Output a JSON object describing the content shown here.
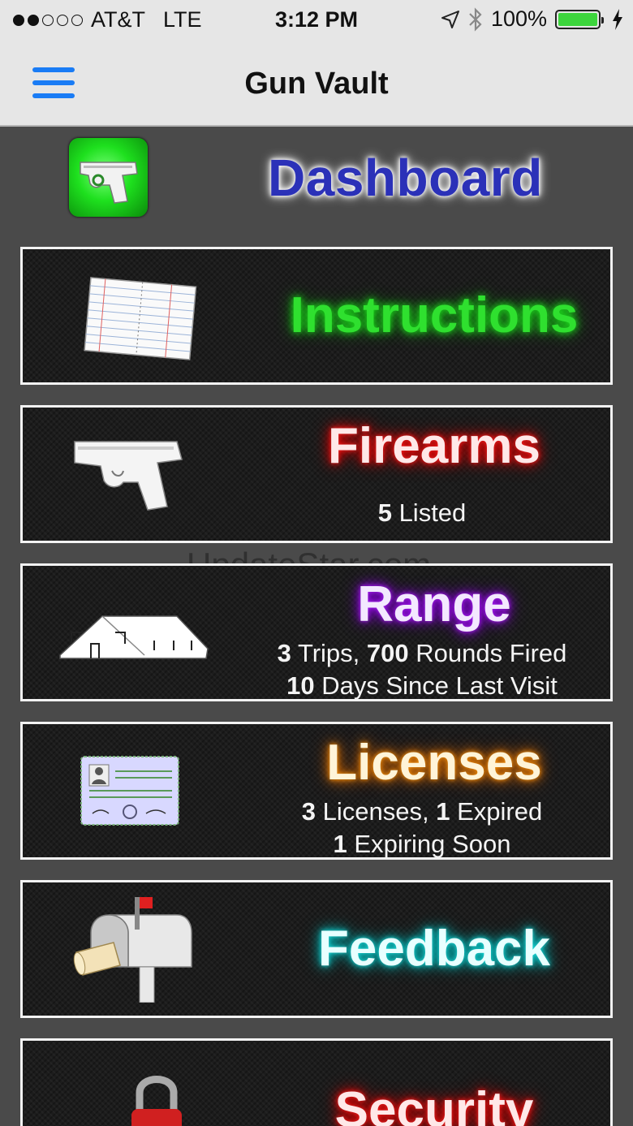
{
  "status_bar": {
    "carrier": "AT&T",
    "network": "LTE",
    "time": "3:12 PM",
    "battery": "100%",
    "signal_bars": 2,
    "signal_total": 5,
    "icons": [
      "location-arrow-icon",
      "bluetooth-icon",
      "battery-icon",
      "charging-bolt-icon"
    ]
  },
  "nav": {
    "title": "Gun Vault",
    "menu_icon": "hamburger-menu-icon",
    "accent": "#1a7cf5"
  },
  "dashboard": {
    "title": "Dashboard",
    "app_icon": "pistol-app-icon"
  },
  "tiles": {
    "instructions": {
      "title": "Instructions",
      "icon": "notebook-icon",
      "color": "#2fe02f"
    },
    "firearms": {
      "title": "Firearms",
      "icon": "pistol-icon",
      "count": "5",
      "count_label": "Listed",
      "color": "#e00000"
    },
    "range": {
      "title": "Range",
      "icon": "building-icon",
      "trips": "3",
      "trips_label": "Trips,",
      "rounds": "700",
      "rounds_label": "Rounds Fired",
      "days": "10",
      "days_label": "Days Since Last Visit",
      "color": "#8c00e0"
    },
    "licenses": {
      "title": "Licenses",
      "icon": "license-card-icon",
      "licenses": "3",
      "licenses_label": "Licenses,",
      "expired": "1",
      "expired_label": "Expired",
      "expiring": "1",
      "expiring_label": "Expiring Soon",
      "color": "#e07000"
    },
    "feedback": {
      "title": "Feedback",
      "icon": "mailbox-icon",
      "color": "#00c0c0"
    },
    "security": {
      "title": "Security",
      "icon": "padlock-icon",
      "color": "#e00000"
    }
  },
  "watermark": "UpdateStar.com"
}
